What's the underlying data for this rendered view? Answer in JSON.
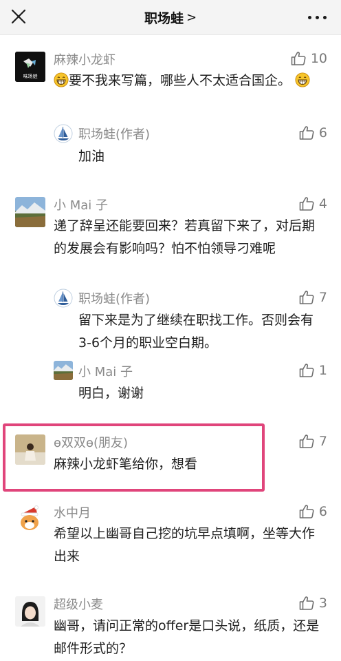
{
  "header": {
    "title": "职场蛙",
    "chevron": ">"
  },
  "comments": [
    {
      "name": "麻辣小龙虾",
      "likes": "10",
      "text": "要不我来写篇，哪些人不太适合国企。",
      "avatar_text": "味场蛙",
      "replies": [
        {
          "name": "职场蛙(作者)",
          "likes": "6",
          "text": "加油"
        }
      ]
    },
    {
      "name": "小 Mai 子",
      "likes": "4",
      "text": "递了辞呈还能要回来？若真留下来了，对后期的发展会有影响吗？怕不怕领导刁难呢",
      "replies": [
        {
          "name": "职场蛙(作者)",
          "likes": "7",
          "text": "留下来是为了继续在职找工作。否则会有3-6个月的职业空白期。"
        },
        {
          "name": "小 Mai 子",
          "likes": "1",
          "text": "明白，谢谢"
        }
      ]
    },
    {
      "name": "ɵ双双ɵ(朋友)",
      "likes": "7",
      "text": "麻辣小龙虾笔给你，想看"
    },
    {
      "name": "水中月",
      "likes": "6",
      "text": "希望以上幽哥自己挖的坑早点填啊，坐等大作出来"
    },
    {
      "name": "超级小麦",
      "likes": "3",
      "text": "幽哥，请问正常的offer是口头说，纸质，还是邮件形式的？"
    }
  ],
  "colors": {
    "highlight": "#e0457b",
    "name_gray": "#8a8a8a",
    "topbar_bg": "#f4f4f4"
  },
  "icons": [
    "close-icon",
    "more-icon",
    "thumbs-up-icon",
    "grin-emoji",
    "sailboat-avatar"
  ]
}
